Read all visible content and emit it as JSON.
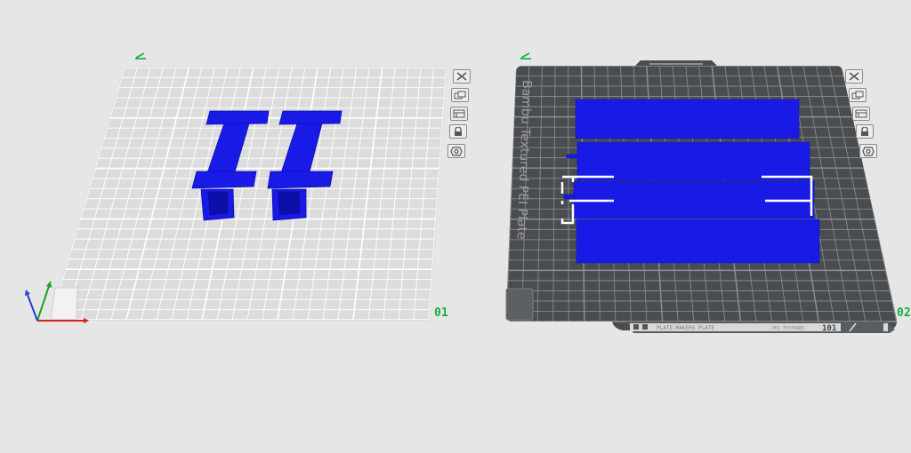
{
  "plates": [
    {
      "number": "01",
      "selected": false,
      "icons": [
        "edit-pencil-icon",
        "close-icon",
        "arrange-icon",
        "layout-icon",
        "lock-icon",
        "settings-icon"
      ]
    },
    {
      "number": "02",
      "selected": true,
      "plate_label": "Bambu Textured PEI Plate",
      "strip_text": "PLATE-MAKERS PLATE",
      "strip_small_text": "PEI TEXTURED",
      "strip_id": "101",
      "icons": [
        "edit-pencil-icon",
        "close-icon",
        "arrange-icon",
        "layout-icon",
        "lock-icon",
        "settings-icon"
      ]
    }
  ],
  "colors": {
    "background": "#e6e6e6",
    "plate1_surface": "#dcdcdc",
    "plate2_surface": "#4a4d50",
    "model": "#1a1ae6",
    "plate_number": "#10b040",
    "axis_x": "#d22020",
    "axis_y": "#20a020",
    "axis_z": "#2040d0"
  }
}
